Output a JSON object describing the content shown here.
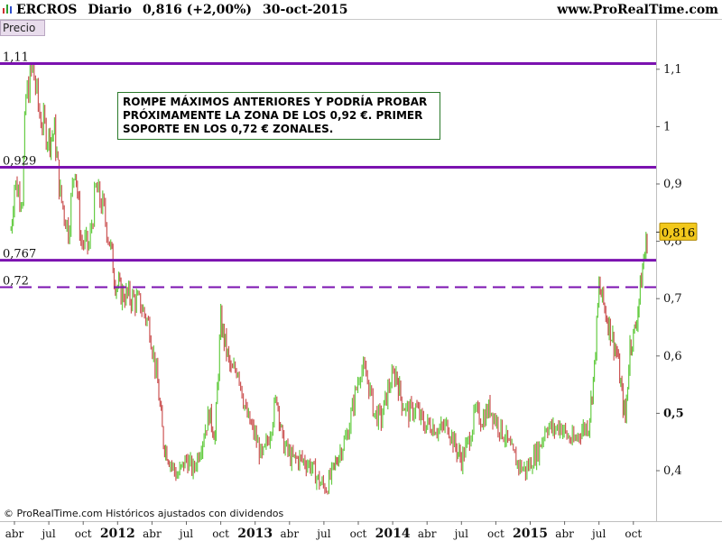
{
  "header": {
    "ticker": "ERCROS",
    "period": "Diario",
    "quote": "0,816 (+2,00%)",
    "date": "30-oct-2015",
    "site": "www.ProRealTime.com"
  },
  "panel_label": "Precio",
  "annotation": "ROMPE MÁXIMOS ANTERIORES Y PODRÍA PROBAR PRÓXIMAMENTE LA ZONA DE LOS 0,92 €. PRIMER SOPORTE EN LOS 0,72 € ZONALES.",
  "footer": "© ProRealTime.com  Históricos ajustados con dividendos",
  "last_price_label": "0,816",
  "colors": {
    "up": "#66cc44",
    "down": "#cc5555",
    "level_line": "#7b12b0",
    "price_tag": "#f2c81c"
  },
  "chart_data": {
    "type": "line",
    "title": "ERCROS Diario",
    "ylim": [
      0.33,
      1.2
    ],
    "y_ticks": [
      {
        "v": 1.1,
        "label": "1,1",
        "bold": false
      },
      {
        "v": 1.0,
        "label": "1",
        "bold": false
      },
      {
        "v": 0.9,
        "label": "0,9",
        "bold": false
      },
      {
        "v": 0.8,
        "label": "0,8",
        "bold": false
      },
      {
        "v": 0.7,
        "label": "0,7",
        "bold": false
      },
      {
        "v": 0.6,
        "label": "0,6",
        "bold": false
      },
      {
        "v": 0.5,
        "label": "0,5",
        "bold": true
      },
      {
        "v": 0.4,
        "label": "0,4",
        "bold": false
      }
    ],
    "x_ticks": [
      {
        "t": 0,
        "label": "abr",
        "bold": false
      },
      {
        "t": 3,
        "label": "jul",
        "bold": false
      },
      {
        "t": 6,
        "label": "oct",
        "bold": false
      },
      {
        "t": 9,
        "label": "2012",
        "bold": true
      },
      {
        "t": 12,
        "label": "abr",
        "bold": false
      },
      {
        "t": 15,
        "label": "jul",
        "bold": false
      },
      {
        "t": 18,
        "label": "oct",
        "bold": false
      },
      {
        "t": 21,
        "label": "2013",
        "bold": true
      },
      {
        "t": 24,
        "label": "abr",
        "bold": false
      },
      {
        "t": 27,
        "label": "jul",
        "bold": false
      },
      {
        "t": 30,
        "label": "oct",
        "bold": false
      },
      {
        "t": 33,
        "label": "2014",
        "bold": true
      },
      {
        "t": 36,
        "label": "abr",
        "bold": false
      },
      {
        "t": 39,
        "label": "jul",
        "bold": false
      },
      {
        "t": 42,
        "label": "oct",
        "bold": false
      },
      {
        "t": 45,
        "label": "2015",
        "bold": true
      },
      {
        "t": 48,
        "label": "abr",
        "bold": false
      },
      {
        "t": 51,
        "label": "jul",
        "bold": false
      },
      {
        "t": 54,
        "label": "oct",
        "bold": false
      }
    ],
    "horizontal_levels": [
      {
        "value": 1.11,
        "label": "1,11",
        "style": "solid"
      },
      {
        "value": 0.929,
        "label": "0,929",
        "style": "solid"
      },
      {
        "value": 0.767,
        "label": "0,767",
        "style": "solid"
      },
      {
        "value": 0.72,
        "label": "0,72",
        "style": "dashed"
      }
    ],
    "last_value": 0.816,
    "series": [
      {
        "values_monthly": [
          [
            -0.3,
            0.82
          ],
          [
            0.0,
            0.9
          ],
          [
            0.7,
            0.88
          ],
          [
            1.0,
            1.05
          ],
          [
            1.6,
            1.1
          ],
          [
            2.2,
            1.02
          ],
          [
            3.0,
            0.98
          ],
          [
            3.5,
            0.99
          ],
          [
            4.0,
            0.88
          ],
          [
            4.7,
            0.82
          ],
          [
            5.3,
            0.94
          ],
          [
            5.8,
            0.8
          ],
          [
            6.5,
            0.79
          ],
          [
            7.1,
            0.89
          ],
          [
            7.7,
            0.86
          ],
          [
            8.3,
            0.8
          ],
          [
            8.8,
            0.73
          ],
          [
            9.3,
            0.71
          ],
          [
            10.3,
            0.7
          ],
          [
            11.0,
            0.69
          ],
          [
            11.8,
            0.65
          ],
          [
            12.5,
            0.55
          ],
          [
            13.0,
            0.45
          ],
          [
            13.5,
            0.42
          ],
          [
            14.2,
            0.39
          ],
          [
            15.0,
            0.42
          ],
          [
            15.6,
            0.4
          ],
          [
            16.2,
            0.44
          ],
          [
            17.0,
            0.5
          ],
          [
            17.5,
            0.46
          ],
          [
            18.0,
            0.66
          ],
          [
            18.4,
            0.62
          ],
          [
            18.9,
            0.57
          ],
          [
            19.5,
            0.58
          ],
          [
            20.2,
            0.5
          ],
          [
            21.0,
            0.46
          ],
          [
            21.6,
            0.42
          ],
          [
            22.2,
            0.46
          ],
          [
            22.9,
            0.53
          ],
          [
            23.4,
            0.45
          ],
          [
            24.2,
            0.42
          ],
          [
            25.0,
            0.42
          ],
          [
            25.8,
            0.41
          ],
          [
            26.6,
            0.38
          ],
          [
            27.2,
            0.37
          ],
          [
            27.8,
            0.4
          ],
          [
            28.3,
            0.43
          ],
          [
            29.0,
            0.46
          ],
          [
            29.6,
            0.52
          ],
          [
            30.2,
            0.58
          ],
          [
            30.8,
            0.56
          ],
          [
            31.4,
            0.5
          ],
          [
            32.0,
            0.49
          ],
          [
            32.7,
            0.55
          ],
          [
            33.3,
            0.57
          ],
          [
            33.8,
            0.52
          ],
          [
            34.4,
            0.5
          ],
          [
            35.0,
            0.51
          ],
          [
            35.7,
            0.48
          ],
          [
            36.4,
            0.48
          ],
          [
            37.1,
            0.47
          ],
          [
            37.8,
            0.48
          ],
          [
            38.5,
            0.44
          ],
          [
            39.0,
            0.42
          ],
          [
            39.6,
            0.45
          ],
          [
            40.2,
            0.5
          ],
          [
            40.8,
            0.49
          ],
          [
            41.5,
            0.51
          ],
          [
            42.2,
            0.48
          ],
          [
            42.8,
            0.46
          ],
          [
            43.4,
            0.43
          ],
          [
            44.0,
            0.41
          ],
          [
            44.6,
            0.4
          ],
          [
            45.2,
            0.42
          ],
          [
            45.8,
            0.44
          ],
          [
            46.4,
            0.48
          ],
          [
            47.0,
            0.47
          ],
          [
            47.6,
            0.48
          ],
          [
            48.2,
            0.46
          ],
          [
            48.8,
            0.45
          ],
          [
            49.4,
            0.47
          ],
          [
            50.1,
            0.48
          ],
          [
            50.6,
            0.58
          ],
          [
            51.0,
            0.72
          ],
          [
            51.4,
            0.69
          ],
          [
            51.8,
            0.66
          ],
          [
            52.2,
            0.63
          ],
          [
            52.6,
            0.6
          ],
          [
            53.0,
            0.53
          ],
          [
            53.3,
            0.49
          ],
          [
            53.7,
            0.62
          ],
          [
            54.1,
            0.64
          ],
          [
            54.5,
            0.7
          ],
          [
            54.9,
            0.77
          ],
          [
            55.3,
            0.816
          ]
        ]
      }
    ]
  }
}
